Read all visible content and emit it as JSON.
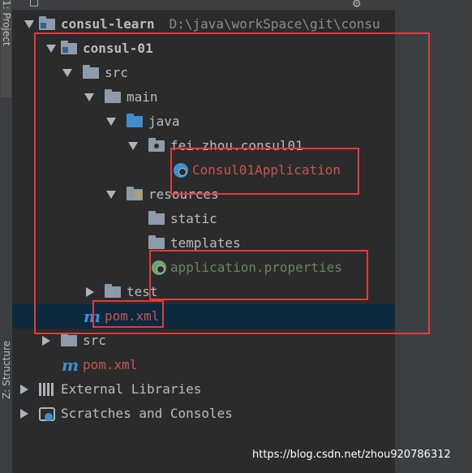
{
  "side_tabs": {
    "project": "1: Project",
    "structure": "Z: Structure"
  },
  "tree": [
    {
      "label": "consul-learn",
      "path": "D:\\java\\workSpace\\git\\consu"
    },
    {
      "label": "consul-01"
    },
    {
      "label": "src"
    },
    {
      "label": "main"
    },
    {
      "label": "java"
    },
    {
      "label": "fei.zhou.consul01"
    },
    {
      "label": "Consul01Application"
    },
    {
      "label": "resources"
    },
    {
      "label": "static"
    },
    {
      "label": "templates"
    },
    {
      "label": "application.properties"
    },
    {
      "label": "test"
    },
    {
      "label": "pom.xml",
      "maven_icon": "m"
    },
    {
      "label": "src"
    },
    {
      "label": "pom.xml",
      "maven_icon": "m"
    },
    {
      "label": "External Libraries"
    },
    {
      "label": "Scratches and Consoles"
    }
  ],
  "watermark": "https://blog.csdn.net/zhou920786312",
  "colors": {
    "annotation_box": "#e5393d",
    "selection": "#0d293e",
    "class_name": "#c75450",
    "properties_file": "#6a8759"
  }
}
